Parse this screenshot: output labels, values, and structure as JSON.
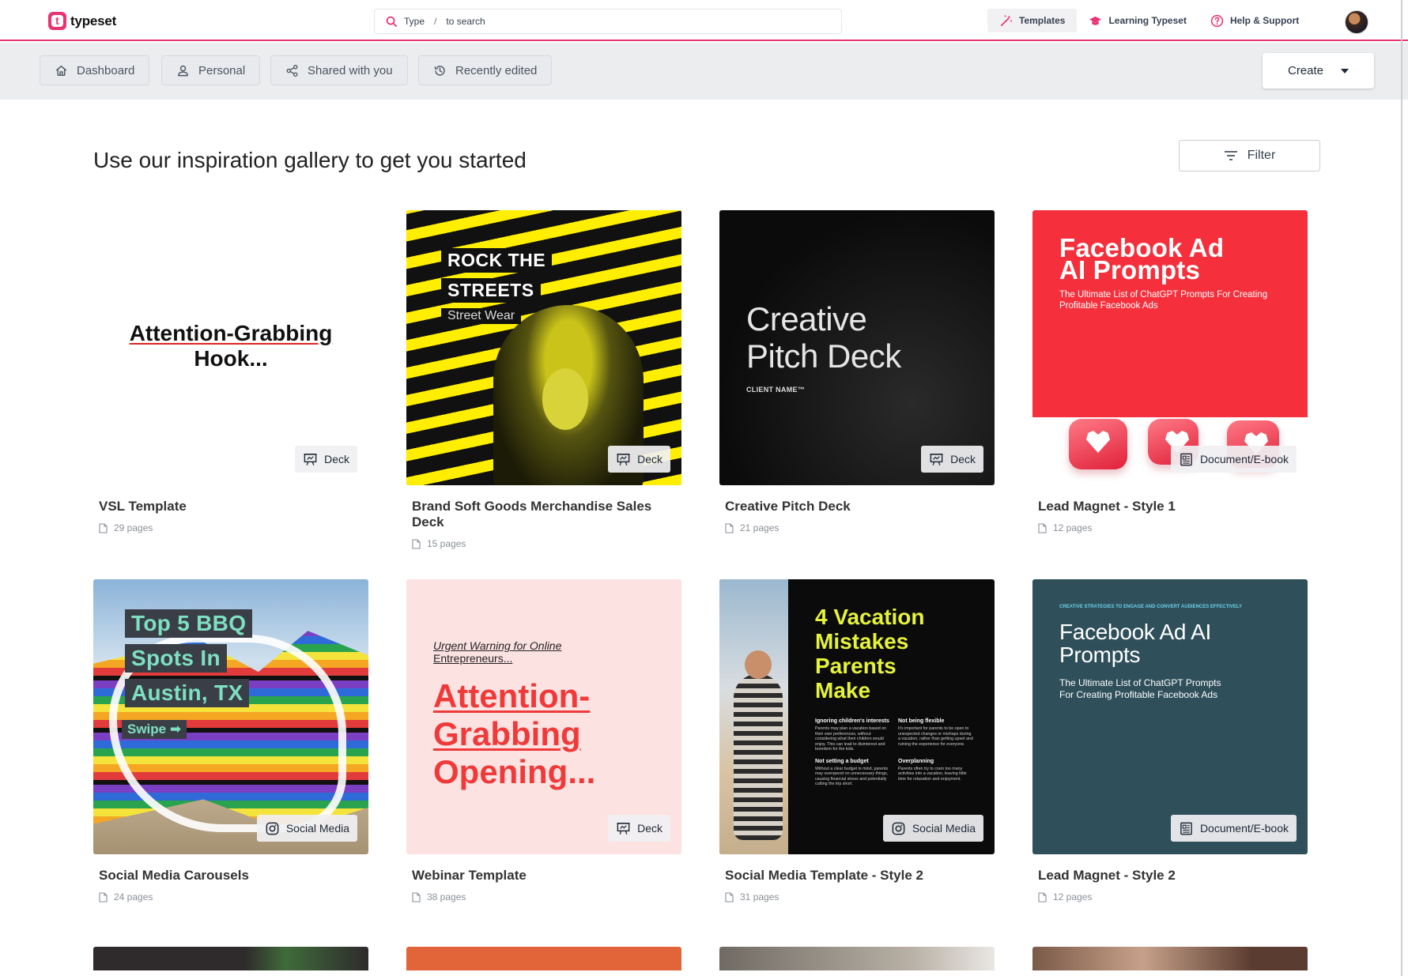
{
  "brand": {
    "name": "typeset",
    "mark": "t",
    "accent": "#e8336f"
  },
  "search": {
    "label": "Type",
    "slash": "/",
    "placeholder": "to search"
  },
  "topnav": {
    "templates": "Templates",
    "learning": "Learning Typeset",
    "help": "Help & Support"
  },
  "subnav": {
    "dashboard": "Dashboard",
    "personal": "Personal",
    "shared": "Shared with you",
    "recent": "Recently edited",
    "create": "Create"
  },
  "main": {
    "heading": "Use our inspiration gallery to get you started",
    "filter": "Filter"
  },
  "cards": [
    {
      "title": "VSL Template",
      "pages": "29 pages",
      "type": "Deck",
      "thumb": {
        "line1": "Attention-Grabbing",
        "line2": "Hook..."
      }
    },
    {
      "title": "Brand Soft Goods Merchandise Sales Deck",
      "pages": "15 pages",
      "type": "Deck",
      "thumb": {
        "line1": "ROCK THE",
        "line2": "STREETS",
        "sub": "Street Wear"
      }
    },
    {
      "title": "Creative Pitch Deck",
      "pages": "21 pages",
      "type": "Deck",
      "thumb": {
        "line1": "Creative",
        "line2": "Pitch Deck",
        "client": "CLIENT NAME™"
      }
    },
    {
      "title": "Lead Magnet - Style 1",
      "pages": "12 pages",
      "type": "Document/E-book",
      "thumb": {
        "line1": "Facebook Ad",
        "line2": "AI Prompts",
        "sub": "The Ultimate List of ChatGPT Prompts For Creating Profitable Facebook Ads"
      }
    },
    {
      "title": "Social Media Carousels",
      "pages": "24 pages",
      "type": "Social Media",
      "thumb": {
        "line1": "Top 5 BBQ",
        "line2": "Spots In",
        "line3": "Austin, TX",
        "swipe": "Swipe ➡"
      }
    },
    {
      "title": "Webinar Template",
      "pages": "38 pages",
      "type": "Deck",
      "thumb": {
        "kicker1": "Urgent Warning for Online",
        "kicker2": "Entrepreneurs...",
        "line1": "Attention-",
        "line2": "Grabbing",
        "line3": "Opening..."
      }
    },
    {
      "title": "Social Media Template - Style 2",
      "pages": "31 pages",
      "type": "Social Media",
      "thumb": {
        "line1": "4 Vacation",
        "line2": "Mistakes",
        "line3": "Parents",
        "line4": "Make",
        "tips": [
          {
            "h": "Ignoring children's interests",
            "p": "Parents may plan a vacation based on their own preferences, without considering what their children would enjoy. This can lead to disinterest and boredom for the kids."
          },
          {
            "h": "Not being flexible",
            "p": "It's important for parents to be open to unexpected changes or mishaps during a vacation, rather than getting upset and ruining the experience for everyone."
          },
          {
            "h": "Not setting a budget",
            "p": "Without a clear budget in mind, parents may overspend on unnecessary things, causing financial stress and potentially cutting the trip short."
          },
          {
            "h": "Overplanning",
            "p": "Parents often try to cram too many activities into a vacation, leaving little time for relaxation and enjoyment."
          }
        ]
      }
    },
    {
      "title": "Lead Magnet - Style 2",
      "pages": "12 pages",
      "type": "Document/E-book",
      "thumb": {
        "kicker": "CREATIVE STRATEGIES TO ENGAGE AND CONVERT AUDIENCES EFFECTIVELY",
        "line1": "Facebook Ad AI",
        "line2": "Prompts",
        "sub": "The Ultimate List of ChatGPT Prompts For Creating Profitable Facebook Ads"
      }
    }
  ]
}
